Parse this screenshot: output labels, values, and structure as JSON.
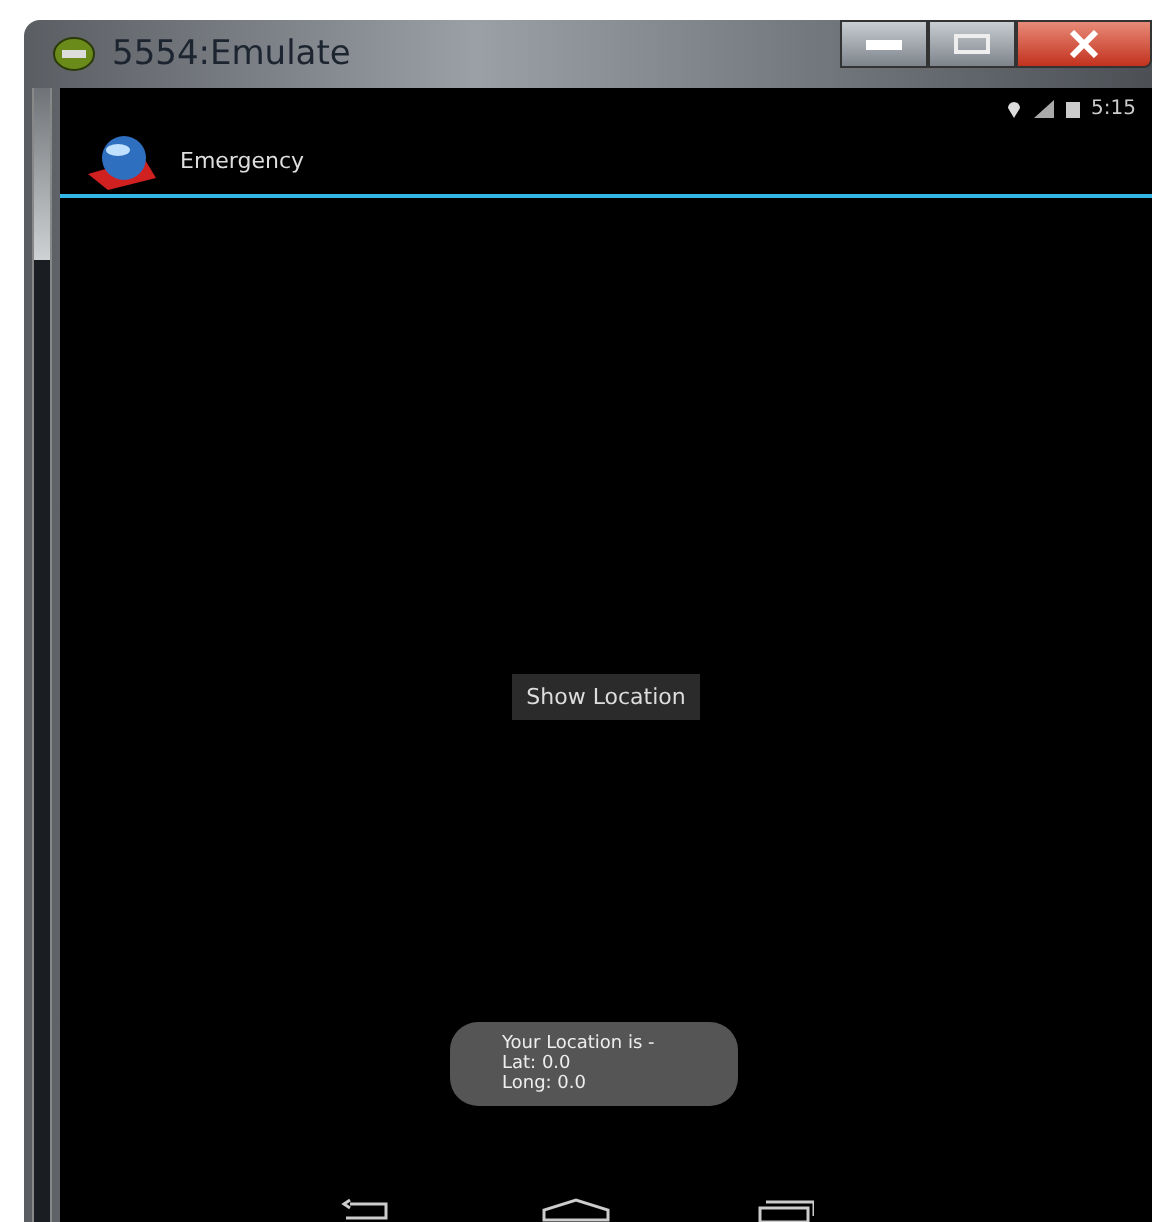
{
  "window": {
    "title": "5554:Emulate"
  },
  "status_bar": {
    "time": "5:15"
  },
  "action_bar": {
    "title": "Emergency"
  },
  "button": {
    "label": "Show Location"
  },
  "toast": {
    "lines": [
      "Your Location is -",
      "Lat: 0.0",
      "Long: 0.0"
    ]
  }
}
